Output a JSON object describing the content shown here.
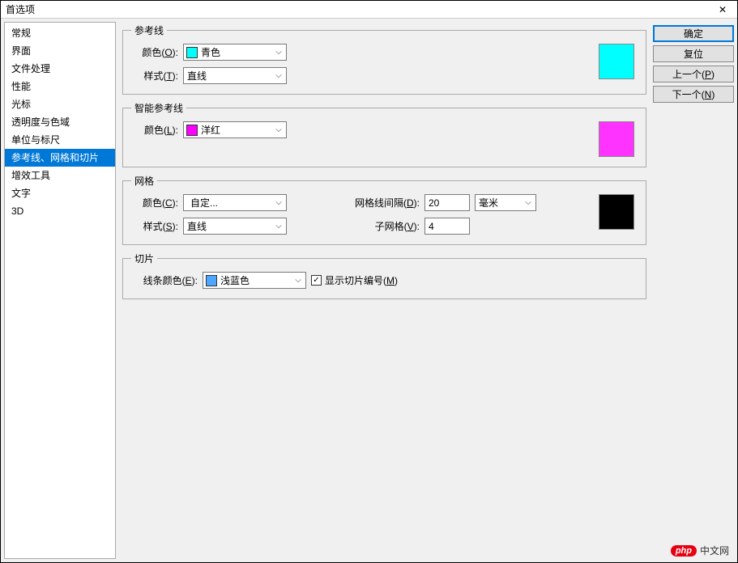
{
  "window": {
    "title": "首选项"
  },
  "sidebar": {
    "items": [
      {
        "label": "常规"
      },
      {
        "label": "界面"
      },
      {
        "label": "文件处理"
      },
      {
        "label": "性能"
      },
      {
        "label": "光标"
      },
      {
        "label": "透明度与色域"
      },
      {
        "label": "单位与标尺"
      },
      {
        "label": "参考线、网格和切片"
      },
      {
        "label": "增效工具"
      },
      {
        "label": "文字"
      },
      {
        "label": "3D"
      }
    ],
    "selectedIndex": 7
  },
  "groups": {
    "guides": {
      "legend": "参考线",
      "color_label": "颜色(O):",
      "color_value": "青色",
      "color_swatch": "#00ffff",
      "style_label": "样式(T):",
      "style_value": "直线",
      "preview_color": "#00ffff"
    },
    "smartGuides": {
      "legend": "智能参考线",
      "color_label": "颜色(L):",
      "color_value": "洋红",
      "color_swatch": "#ff00ff",
      "preview_color": "#ff33ff"
    },
    "grid": {
      "legend": "网格",
      "color_label": "颜色(C):",
      "color_value": "自定...",
      "style_label": "样式(S):",
      "style_value": "直线",
      "interval_label": "网格线间隔(D):",
      "interval_value": "20",
      "unit_value": "毫米",
      "subdiv_label": "子网格(V):",
      "subdiv_value": "4",
      "preview_color": "#000000"
    },
    "slices": {
      "legend": "切片",
      "color_label": "线条颜色(E):",
      "color_value": "浅蓝色",
      "color_swatch": "#4da6ff",
      "show_numbers_label": "显示切片编号(M)",
      "show_numbers_checked": true
    }
  },
  "buttons": {
    "ok": "确定",
    "reset": "复位",
    "prev": "上一个(P)",
    "next": "下一个(N)"
  },
  "watermark": {
    "badge": "php",
    "text": "中文网"
  }
}
